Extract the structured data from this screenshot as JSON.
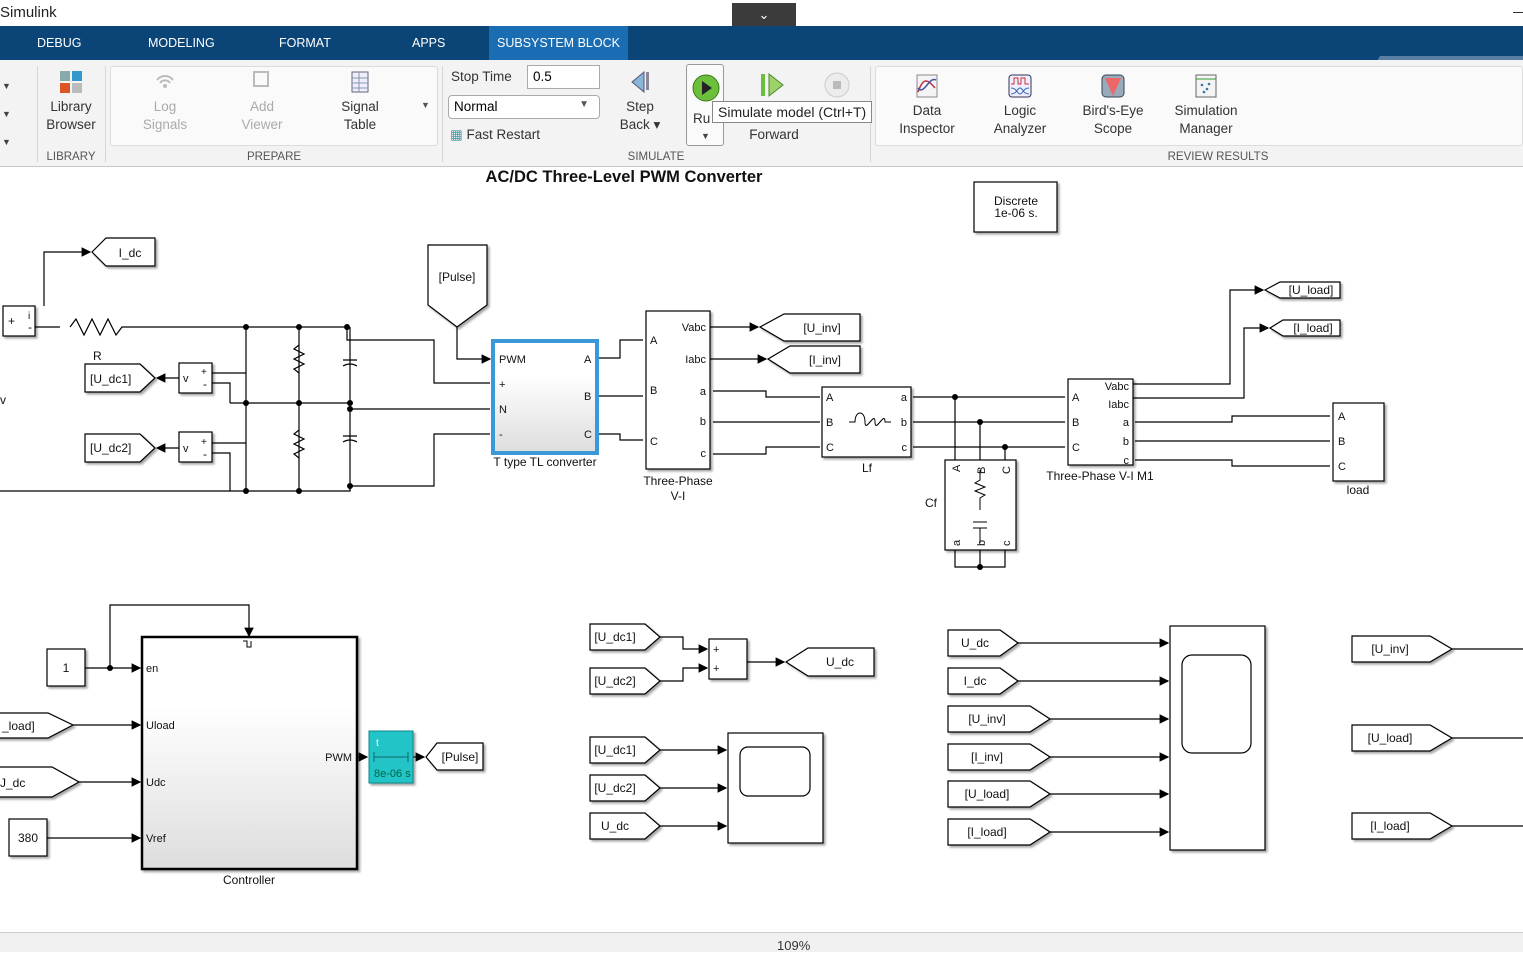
{
  "window": {
    "title": "Simulink",
    "collapse_icon": "chevron-down-icon"
  },
  "tabs": [
    {
      "label": "DEBUG"
    },
    {
      "label": "MODELING"
    },
    {
      "label": "FORMAT"
    },
    {
      "label": "APPS"
    },
    {
      "label": "SUBSYSTEM BLOCK",
      "active": true
    }
  ],
  "quick_access": [
    "save-icon",
    "undo-icon",
    "redo-icon",
    "search-icon",
    "more-icon"
  ],
  "ribbon": {
    "library": {
      "browser": [
        "Library",
        "Browser"
      ],
      "group": "LIBRARY"
    },
    "prepare": {
      "log": [
        "Log",
        "Signals"
      ],
      "add": [
        "Add",
        "Viewer"
      ],
      "table": [
        "Signal",
        "Table"
      ],
      "group": "PREPARE"
    },
    "simulate": {
      "stop_time_label": "Stop Time",
      "stop_time": "0.5",
      "mode": "Normal",
      "fast_restart": "Fast Restart",
      "step_back": [
        "Step",
        "Back"
      ],
      "run": "Ru",
      "step_forward": "Forward",
      "group": "SIMULATE"
    },
    "review": {
      "data": [
        "Data",
        "Inspector"
      ],
      "logic": [
        "Logic",
        "Analyzer"
      ],
      "birds": [
        "Bird's-Eye",
        "Scope"
      ],
      "sim": [
        "Simulation",
        "Manager"
      ],
      "group": "REVIEW RESULTS"
    },
    "tooltip": "Simulate model (Ctrl+T)"
  },
  "diagram": {
    "title": "AC/DC Three-Level PWM Converter",
    "solver": [
      "Discrete",
      "1e-06 s."
    ],
    "tags": {
      "I_dc": "I_dc",
      "U_dc1": "[U_dc1]",
      "U_dc2": "[U_dc2]",
      "Pulse": "[Pulse]",
      "U_inv": "[U_inv]",
      "I_inv": "[I_inv]",
      "U_load": "[U_load]",
      "I_load": "[I_load]",
      "U_dc": "U_dc",
      "U_load_partial": "_load]",
      "U_dc_partial": "J_dc"
    },
    "labels": {
      "R": "R",
      "v": "v",
      "converter": "T type TL converter",
      "vi1": [
        "Three-Phase",
        "V-I"
      ],
      "Lf": "Lf",
      "Cf": "Cf",
      "vi2": "Three-Phase V-I M1",
      "load": "load",
      "controller": "Controller"
    },
    "ports": {
      "pwm": "PWM",
      "plus": "+",
      "minus": "-",
      "N": "N",
      "A": "A",
      "B": "B",
      "C": "C",
      "a": "a",
      "b": "b",
      "c": "c",
      "Vabc": "Vabc",
      "Iabc": "Iabc",
      "i": "i",
      "v": "v",
      "en": "en",
      "Uload": "Uload",
      "Udc": "Udc",
      "Vref": "Vref"
    },
    "constants": {
      "one": "1",
      "vref": "380"
    },
    "zoh": {
      "t": "t",
      "ts": "8e-06 s"
    }
  },
  "status": {
    "zoom": "109%"
  },
  "colors": {
    "tabbar": "#0b4577",
    "active_tab": "#1b6db3",
    "selection": "#3a9ad9",
    "zoh": "#20c4c8"
  }
}
